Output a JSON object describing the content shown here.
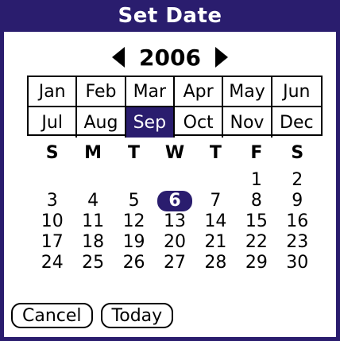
{
  "title": "Set Date",
  "year": {
    "label": "2006",
    "prev_icon": "triangle-left-icon",
    "next_icon": "triangle-right-icon"
  },
  "months": [
    "Jan",
    "Feb",
    "Mar",
    "Apr",
    "May",
    "Jun",
    "Jul",
    "Aug",
    "Sep",
    "Oct",
    "Nov",
    "Dec"
  ],
  "selected_month": "Sep",
  "weekdays": [
    "S",
    "M",
    "T",
    "W",
    "T",
    "F",
    "S"
  ],
  "weeks": [
    [
      "",
      "",
      "",
      "",
      "",
      "1",
      "2"
    ],
    [
      "3",
      "4",
      "5",
      "6",
      "7",
      "8",
      "9"
    ],
    [
      "10",
      "11",
      "12",
      "13",
      "14",
      "15",
      "16"
    ],
    [
      "17",
      "18",
      "19",
      "20",
      "21",
      "22",
      "23"
    ],
    [
      "24",
      "25",
      "26",
      "27",
      "28",
      "29",
      "30"
    ]
  ],
  "selected_day": "6",
  "buttons": {
    "cancel": "Cancel",
    "today": "Today"
  },
  "colors": {
    "accent": "#2a1d6e"
  }
}
